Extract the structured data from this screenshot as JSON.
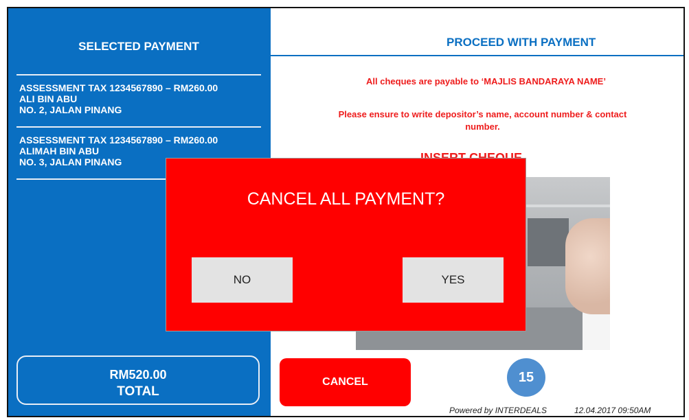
{
  "left": {
    "title": "SELECTED PAYMENT",
    "items": [
      {
        "line1": "ASSESSMENT TAX 1234567890 – RM260.00",
        "line2": "ALI BIN ABU",
        "line3": "NO. 2, JALAN PINANG"
      },
      {
        "line1": "ASSESSMENT TAX 1234567890 – RM260.00",
        "line2": "ALIMAH BIN ABU",
        "line3": "NO. 3, JALAN PINANG"
      }
    ],
    "total_amount": "RM520.00",
    "total_label": "TOTAL"
  },
  "right": {
    "title": "PROCEED WITH PAYMENT",
    "notice1": "All cheques are payable to ‘MAJLIS BANDARAYA NAME’",
    "notice2_line1": "Please ensure to write depositor’s name, account number & contact",
    "notice2_line2": "number.",
    "insert_label": "INSERT CHEQUE",
    "cancel_label": "CANCEL",
    "countdown": "15",
    "powered_by": "Powered by INTERDEALS",
    "timestamp": "12.04.2017 09:50AM"
  },
  "modal": {
    "title": "CANCEL ALL PAYMENT?",
    "no_label": "NO",
    "yes_label": "YES"
  },
  "colors": {
    "left_panel": "#0a6fc2",
    "accent_red": "#ff0000",
    "notice_red": "#ee1c1c",
    "timer_blue": "#4f8fd0"
  }
}
